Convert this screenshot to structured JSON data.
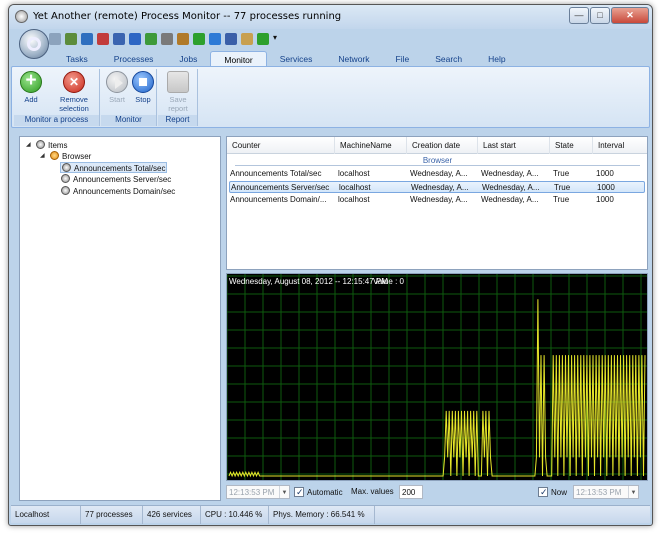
{
  "window": {
    "title": "Yet Another (remote) Process Monitor -- 77 processes running"
  },
  "title_buttons": {
    "minimize": "—",
    "maximize": "□",
    "close": "✕"
  },
  "quick_access": [
    "new-icon",
    "monitor-icon",
    "screen-icon",
    "target-icon",
    "network-icon",
    "info-icon",
    "shield-icon",
    "tools-icon",
    "hook-icon",
    "add-icon",
    "globe-icon",
    "save-icon",
    "copy-icon",
    "check-icon",
    "dropdown-icon"
  ],
  "tabs": [
    "Tasks",
    "Processes",
    "Jobs",
    "Monitor",
    "Services",
    "Network",
    "File",
    "Search",
    "Help"
  ],
  "active_tab": "Monitor",
  "ribbon": {
    "groups": [
      {
        "label": "Monitor a process",
        "buttons": [
          {
            "label": "Add",
            "icon": "add-icon"
          },
          {
            "label": "Remove selection",
            "icon": "remove-icon"
          }
        ]
      },
      {
        "label": "Monitor",
        "buttons": [
          {
            "label": "Start",
            "icon": "play-icon",
            "disabled": true
          },
          {
            "label": "Stop",
            "icon": "stop-icon"
          }
        ]
      },
      {
        "label": "Report",
        "buttons": [
          {
            "label": "Save report",
            "icon": "save-report-icon",
            "disabled": true
          }
        ]
      }
    ]
  },
  "tree": {
    "root": "Items",
    "group": "Browser",
    "children": [
      "Announcements Total/sec",
      "Announcements Server/sec",
      "Announcements Domain/sec"
    ],
    "selected": "Announcements Total/sec"
  },
  "grid": {
    "columns": [
      "Counter",
      "MachineName",
      "Creation date",
      "Last start",
      "State",
      "Interval"
    ],
    "group_label": "Browser",
    "rows": [
      [
        "Announcements Total/sec",
        "localhost",
        "Wednesday, A...",
        "Wednesday, A...",
        "True",
        "1000"
      ],
      [
        "Announcements Server/sec",
        "localhost",
        "Wednesday, A...",
        "Wednesday, A...",
        "True",
        "1000"
      ],
      [
        "Announcements Domain/...",
        "localhost",
        "Wednesday, A...",
        "Wednesday, A...",
        "True",
        "1000"
      ]
    ],
    "selected_row": 1
  },
  "chart_data": {
    "type": "line",
    "title": "",
    "overlay_text": "Wednesday, August 08, 2012 -- 12:15:47 PM",
    "overlay_value": "Value : 0",
    "background": "#000000",
    "grid_color": "#0e5a0e",
    "line_color": "#e6e62a",
    "grid": true,
    "ylim": [
      0,
      1
    ],
    "series": [
      {
        "values": [
          0,
          0.02,
          0,
          0.02,
          0,
          0.02,
          0,
          0.02,
          0,
          0.02,
          0,
          0.02,
          0,
          0.02,
          0,
          0.02,
          0,
          0.02,
          0,
          0.02,
          0,
          0,
          0,
          0,
          0,
          0,
          0,
          0,
          0,
          0,
          0,
          0,
          0,
          0,
          0,
          0,
          0,
          0,
          0,
          0,
          0,
          0,
          0,
          0,
          0,
          0,
          0,
          0,
          0,
          0,
          0,
          0,
          0,
          0,
          0,
          0,
          0,
          0,
          0,
          0,
          0,
          0,
          0,
          0,
          0,
          0,
          0,
          0,
          0,
          0,
          0,
          0,
          0,
          0,
          0,
          0,
          0,
          0,
          0,
          0,
          0,
          0,
          0,
          0,
          0,
          0,
          0,
          0,
          0,
          0,
          0,
          0,
          0,
          0,
          0,
          0,
          0,
          0,
          0,
          0,
          0,
          0,
          0,
          0,
          0,
          0,
          0,
          0,
          0,
          0,
          0,
          0,
          0,
          0,
          0,
          0,
          0,
          0,
          0,
          0,
          0,
          0,
          0,
          0,
          0,
          0,
          0,
          0,
          0,
          0,
          0,
          0,
          0,
          0,
          0,
          0,
          0,
          0,
          0,
          0,
          0,
          0.1,
          0.35,
          0.1,
          0.35,
          0,
          0.35,
          0.1,
          0.35,
          0,
          0.35,
          0.1,
          0.35,
          0,
          0.35,
          0.1,
          0.35,
          0,
          0.35,
          0.1,
          0.35,
          0,
          0.35,
          0,
          0,
          0,
          0.35,
          0.1,
          0.35,
          0,
          0.35,
          0.1,
          0,
          0,
          0,
          0,
          0,
          0,
          0,
          0,
          0,
          0,
          0,
          0,
          0,
          0,
          0,
          0,
          0,
          0,
          0,
          0,
          0,
          0,
          0,
          0,
          0,
          0,
          0,
          0,
          0,
          0.1,
          0.95,
          0.1,
          0.65,
          0,
          0.65,
          0.1,
          0,
          0,
          0,
          0,
          0.65,
          0.1,
          0.65,
          0,
          0.65,
          0.1,
          0.65,
          0,
          0.65,
          0.1,
          0.65,
          0,
          0.65,
          0.1,
          0.65,
          0,
          0.65,
          0.1,
          0.65,
          0,
          0.65,
          0.1,
          0.65,
          0,
          0.65,
          0.1,
          0.65,
          0,
          0.65,
          0.1,
          0.65,
          0,
          0.65,
          0.1,
          0.65,
          0,
          0.65,
          0.1,
          0.65,
          0,
          0.65,
          0.1,
          0.65,
          0,
          0.65,
          0.1,
          0.65,
          0,
          0.65,
          0.1,
          0.65,
          0,
          0.65,
          0.1,
          0.65,
          0,
          0.65,
          0.1,
          0.65,
          0,
          0.65
        ]
      }
    ]
  },
  "chart_controls": {
    "start_time": "12:13:53 PM",
    "automatic_label": "Automatic",
    "automatic_checked": true,
    "max_values_label": "Max. values",
    "max_values": "200",
    "now_label": "Now",
    "now_checked": true,
    "end_time": "12:13:53 PM"
  },
  "status": {
    "machine": "Localhost",
    "processes": "77 processes",
    "services": "426 services",
    "cpu": "CPU : 10.446 %",
    "memory": "Phys. Memory : 66.541 %"
  }
}
